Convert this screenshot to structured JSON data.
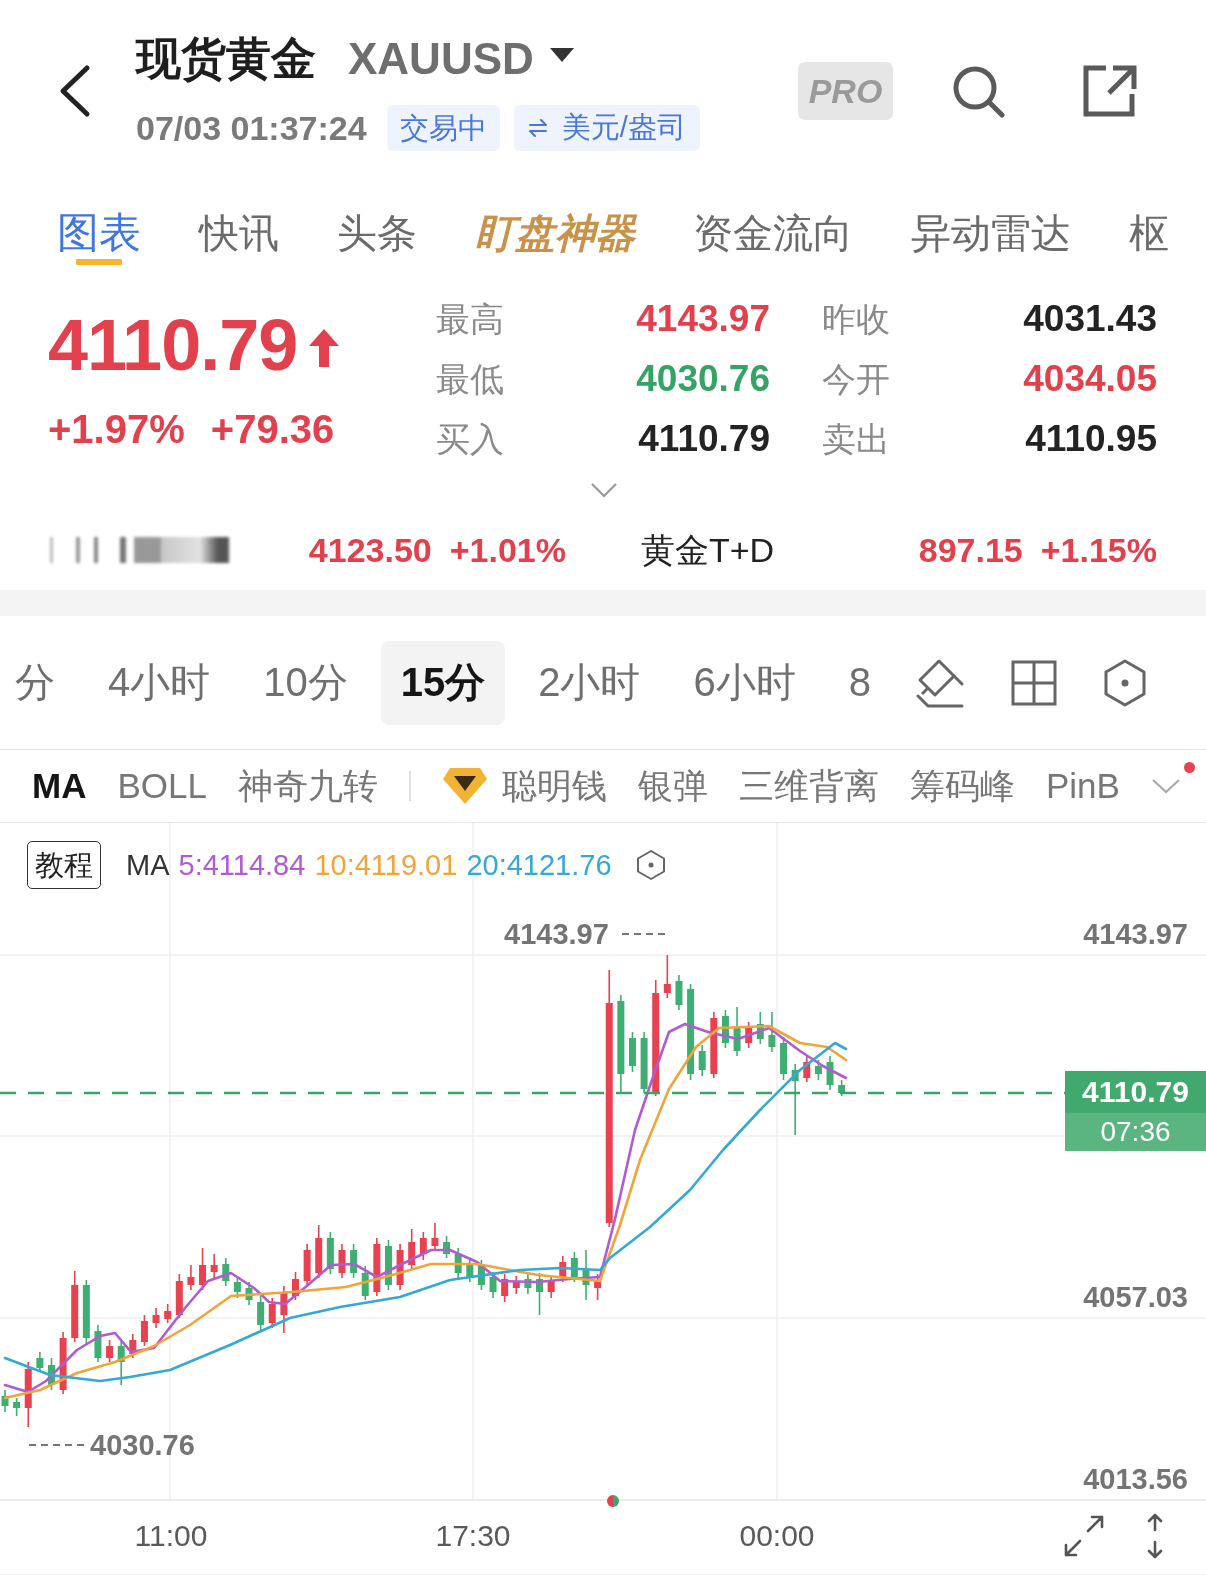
{
  "header": {
    "title": "现货黄金",
    "symbol": "XAUUSD",
    "datetime": "07/03 01:37:24",
    "status": "交易中",
    "unit": "美元/盎司",
    "pro_label": "PRO"
  },
  "tabs": [
    {
      "label": "图表",
      "kind": "plain",
      "selected": true
    },
    {
      "label": "快讯",
      "kind": "plain",
      "selected": false
    },
    {
      "label": "头条",
      "kind": "plain",
      "selected": false
    },
    {
      "label": "盯盘神器",
      "kind": "featured",
      "selected": false
    },
    {
      "label": "资金流向",
      "kind": "plain",
      "selected": false
    },
    {
      "label": "异动雷达",
      "kind": "plain",
      "selected": false
    },
    {
      "label": "枢",
      "kind": "plain",
      "selected": false
    }
  ],
  "quote": {
    "price": "4110.79",
    "color": "#e3404e",
    "rising": true,
    "change_percent": "+1.97%",
    "change": "+79.36",
    "stats": [
      {
        "label": "最高",
        "value": "4143.97",
        "color": "#e3404e"
      },
      {
        "label": "昨收",
        "value": "4031.43",
        "color": "#232323"
      },
      {
        "label": "最低",
        "value": "4030.76",
        "color": "#35a366"
      },
      {
        "label": "今开",
        "value": "4034.05",
        "color": "#e3404e"
      },
      {
        "label": "买入",
        "value": "4110.79",
        "color": "#232323"
      },
      {
        "label": "卖出",
        "value": "4110.95",
        "color": "#232323"
      }
    ]
  },
  "related": [
    {
      "kind": "blurred",
      "price": "4123.50",
      "change": "+1.01%",
      "color": "#e3404e"
    },
    {
      "kind": "named",
      "name": "黄金T+D",
      "price": "897.15",
      "change": "+1.15%",
      "color": "#e3404e"
    }
  ],
  "intervals": [
    {
      "label": "分",
      "selected": false
    },
    {
      "label": "4小时",
      "selected": false
    },
    {
      "label": "10分",
      "selected": false
    },
    {
      "label": "15分",
      "selected": true
    },
    {
      "label": "2小时",
      "selected": false
    },
    {
      "label": "6小时",
      "selected": false
    },
    {
      "label": "8",
      "selected": false
    }
  ],
  "indicators": [
    {
      "label": "MA",
      "kind": "basic",
      "selected": true
    },
    {
      "label": "BOLL",
      "kind": "basic",
      "selected": false
    },
    {
      "label": "神奇九转",
      "kind": "basic",
      "selected": false
    },
    {
      "label": "聪明钱",
      "kind": "premium",
      "selected": false
    },
    {
      "label": "银弹",
      "kind": "basic",
      "selected": false
    },
    {
      "label": "三维背离",
      "kind": "basic",
      "selected": false
    },
    {
      "label": "筹码峰",
      "kind": "basic",
      "selected": false
    },
    {
      "label": "PinB",
      "kind": "basic",
      "selected": false
    }
  ],
  "indicator_menu": {
    "has_update": true
  },
  "chart": {
    "tutorial": "教程",
    "ma_label": "MA",
    "ma_lines": [
      {
        "label": "5:4114.84",
        "color": "#b05cd0"
      },
      {
        "label": "10:4119.01",
        "color": "#f1a43a"
      },
      {
        "label": "20:4121.76",
        "color": "#35a8d3"
      }
    ],
    "price_labels": [
      "4143.97",
      "4057.03",
      "4013.56"
    ],
    "high_label": "4143.97",
    "low_label": "4030.76",
    "last_price": "4110.79",
    "countdown": "07:36",
    "time_labels": [
      "11:00",
      "17:30",
      "00:00"
    ]
  }
}
